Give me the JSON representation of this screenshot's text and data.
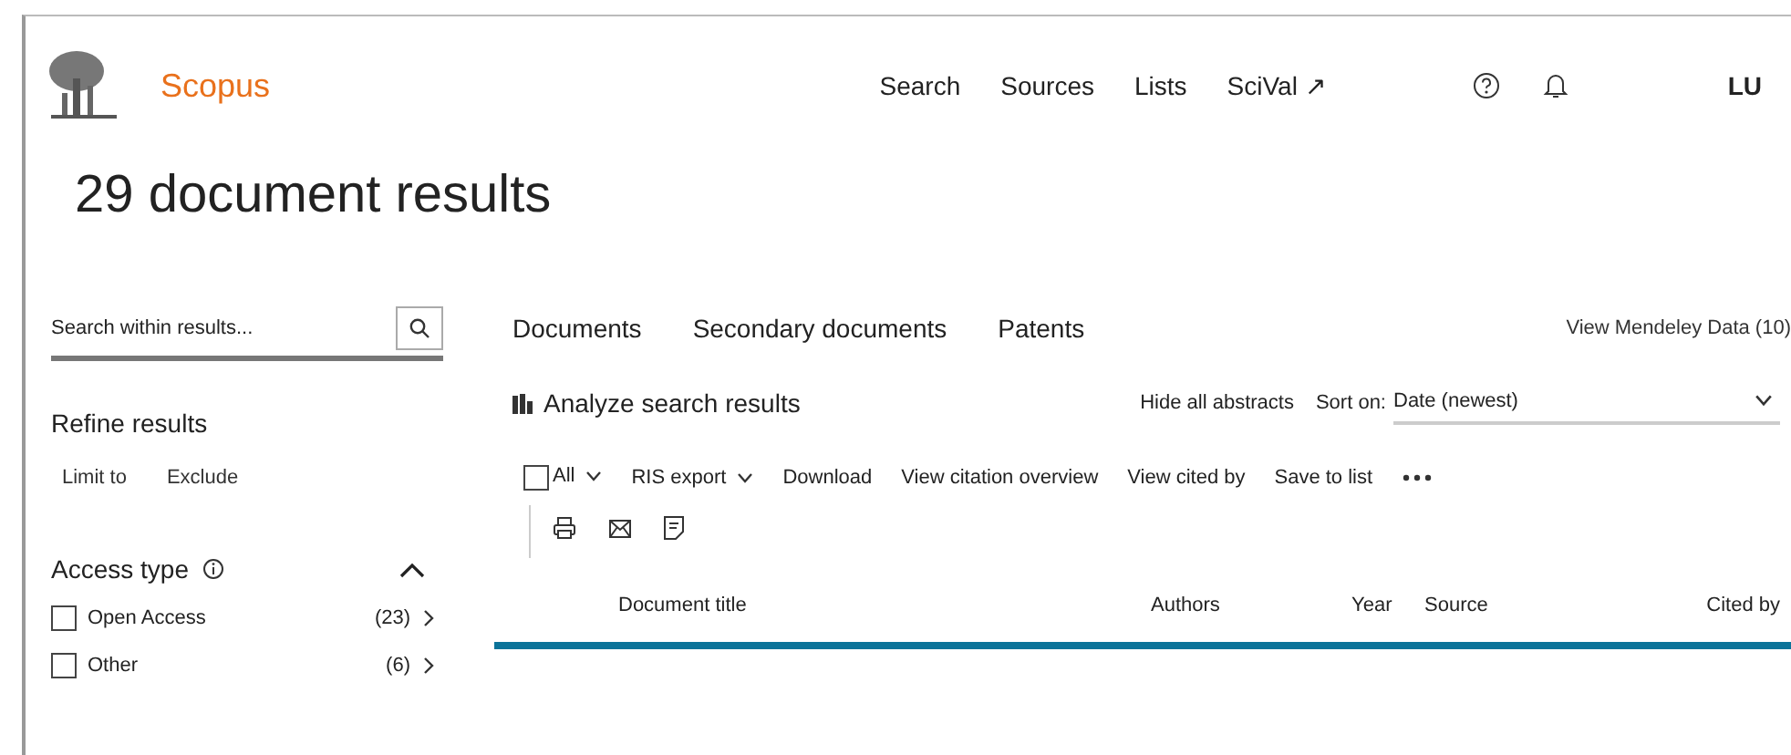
{
  "header": {
    "brand": "Scopus",
    "nav": [
      "Search",
      "Sources",
      "Lists",
      "SciVal ↗"
    ],
    "user_initials": "LU"
  },
  "title": "29 document results",
  "sidebar": {
    "search": {
      "placeholder": "Search within results..."
    },
    "refine_title": "Refine results",
    "refine_actions": [
      "Limit to",
      "Exclude"
    ],
    "filter_group": {
      "title": "Access type",
      "expanded": true,
      "options": [
        {
          "label": "Open Access",
          "count": "(23)",
          "checked": false
        },
        {
          "label": "Other",
          "count": "(6)",
          "checked": false
        }
      ]
    }
  },
  "tabs": [
    {
      "label": "Documents"
    },
    {
      "label": "Secondary documents"
    },
    {
      "label": "Patents"
    }
  ],
  "mendeley_link": "View Mendeley Data (10)",
  "analyze_link": "Analyze search results",
  "hide_abstracts": "Hide all abstracts",
  "sort": {
    "label": "Sort on:",
    "value": "Date (newest)"
  },
  "toolbar": {
    "select_all": {
      "label": "All",
      "checked": false
    },
    "actions": [
      "RIS export",
      "Download",
      "View citation overview",
      "View cited by",
      "Save to list"
    ]
  },
  "table": {
    "columns": [
      "Document title",
      "Authors",
      "Year",
      "Source",
      "Cited by"
    ]
  }
}
